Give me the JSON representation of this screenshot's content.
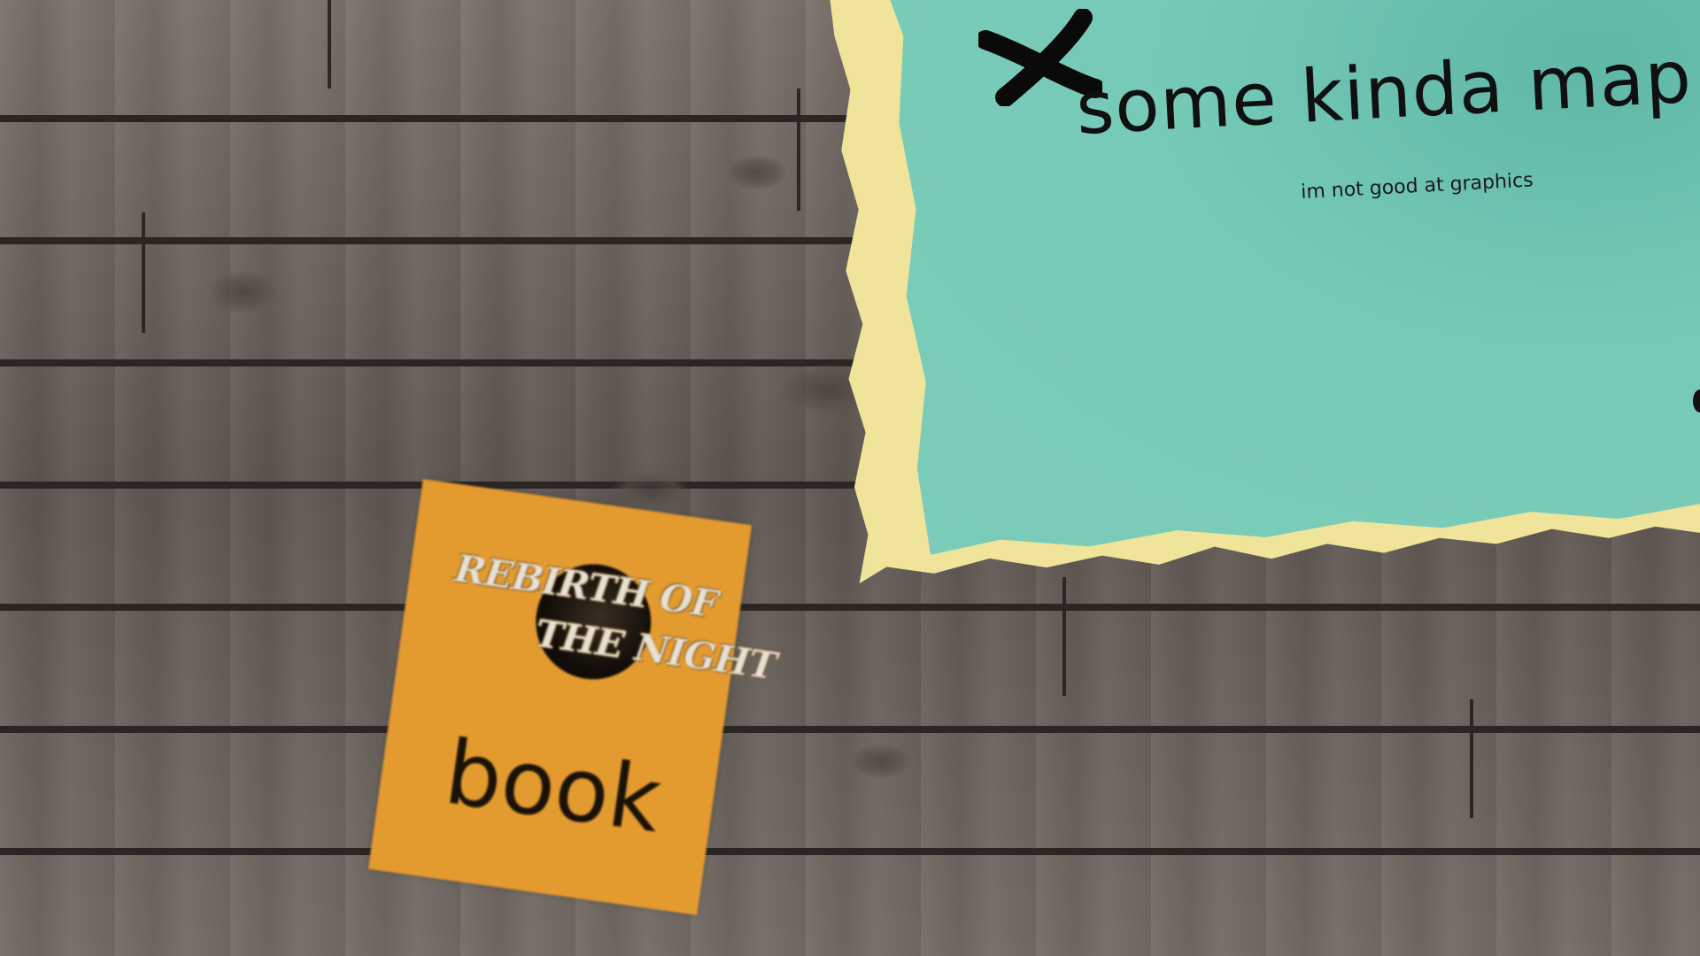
{
  "map": {
    "title": "some kinda map",
    "subtitle": "im not good at graphics",
    "x_icon": "x-mark-icon",
    "paper_color": "#efe49a",
    "sea_color": "#7bcdb9"
  },
  "book": {
    "logo_line_1": "REBIRTH OF",
    "logo_line_2": "THE NIGHT",
    "label": "book",
    "cover_color": "#e39a2f"
  },
  "background": {
    "texture": "wooden-planks",
    "color": "#6a625d"
  }
}
